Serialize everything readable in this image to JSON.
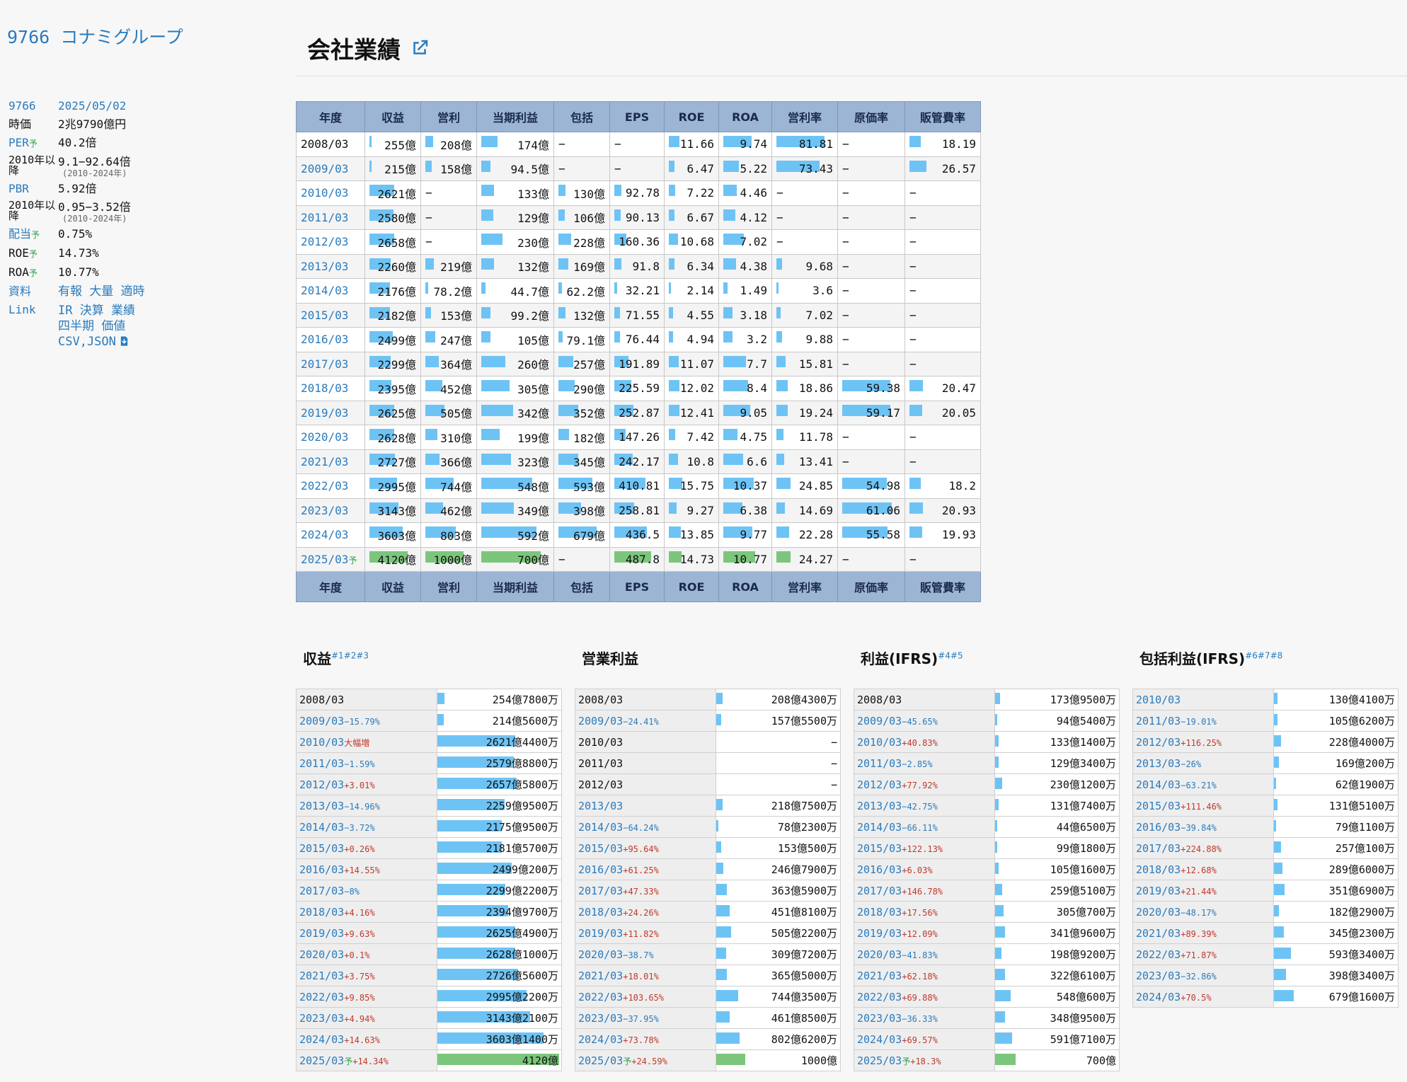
{
  "company": {
    "title": "9766 コナミグループ"
  },
  "side": {
    "code": "9766",
    "date": "2025/05/02",
    "rows": [
      {
        "k": "時価",
        "v": "2兆9790億円"
      },
      {
        "k": "PER",
        "yo": "予",
        "v": "40.2倍",
        "blue": true
      },
      {
        "k": "2010年以降",
        "v": "9.1−92.64倍",
        "note": "(2010-2024年)"
      },
      {
        "k": "PBR",
        "v": "5.92倍",
        "blue": true
      },
      {
        "k": "2010年以降",
        "v": "0.95−3.52倍",
        "note": "(2010-2024年)"
      },
      {
        "k": "配当",
        "yo": "予",
        "v": "0.75%",
        "blue": true
      },
      {
        "k": "ROE",
        "yo": "予",
        "v": "14.73%"
      },
      {
        "k": "ROA",
        "yo": "予",
        "v": "10.77%"
      }
    ],
    "docs_label": "資料",
    "docs": [
      "有報",
      "大量",
      "適時"
    ],
    "link_label": "Link",
    "links": [
      "IR",
      "決算",
      "業績",
      "四半期",
      "価値",
      "CSV,JSON"
    ]
  },
  "main": {
    "title": "会社業績"
  },
  "perf": {
    "headers": [
      "年度",
      "収益",
      "営利",
      "当期利益",
      "包括",
      "EPS",
      "ROE",
      "ROA",
      "営利率",
      "原価率",
      "販管費率"
    ],
    "rows": [
      {
        "y": "2008/03",
        "c": [
          "255億",
          "208億",
          "174億",
          "−",
          "−",
          "11.66",
          "9.74",
          "81.81",
          "−",
          "18.19"
        ],
        "b": [
          0.06,
          0.2,
          0.27,
          0,
          0,
          0.28,
          0.8,
          1.0,
          0,
          0.2
        ]
      },
      {
        "y": "2009/03",
        "c": [
          "215億",
          "158億",
          "94.5億",
          "−",
          "−",
          "6.47",
          "5.22",
          "73.43",
          "−",
          "26.57"
        ],
        "b": [
          0.05,
          0.16,
          0.15,
          0,
          0,
          0.16,
          0.43,
          0.9,
          0,
          0.29
        ]
      },
      {
        "y": "2010/03",
        "c": [
          "2621億",
          "−",
          "133億",
          "130億",
          "92.78",
          "7.22",
          "4.46",
          "−",
          "−",
          "−"
        ],
        "b": [
          0.64,
          0,
          0.21,
          0.19,
          0.19,
          0.17,
          0.37,
          0,
          0,
          0
        ]
      },
      {
        "y": "2011/03",
        "c": [
          "2580億",
          "−",
          "129億",
          "106億",
          "90.13",
          "6.67",
          "4.12",
          "−",
          "−",
          "−"
        ],
        "b": [
          0.63,
          0,
          0.2,
          0.16,
          0.18,
          0.16,
          0.34,
          0,
          0,
          0
        ]
      },
      {
        "y": "2012/03",
        "c": [
          "2658億",
          "−",
          "230億",
          "228億",
          "160.36",
          "10.68",
          "7.02",
          "−",
          "−",
          "−"
        ],
        "b": [
          0.65,
          0,
          0.36,
          0.34,
          0.33,
          0.25,
          0.58,
          0,
          0,
          0
        ]
      },
      {
        "y": "2013/03",
        "c": [
          "2260億",
          "219億",
          "132億",
          "169億",
          "91.8",
          "6.34",
          "4.38",
          "9.68",
          "−",
          "−"
        ],
        "b": [
          0.55,
          0.22,
          0.21,
          0.25,
          0.19,
          0.15,
          0.36,
          0.12,
          0,
          0
        ]
      },
      {
        "y": "2014/03",
        "c": [
          "2176億",
          "78.2億",
          "44.7億",
          "62.2億",
          "32.21",
          "2.14",
          "1.49",
          "3.6",
          "−",
          "−"
        ],
        "b": [
          0.53,
          0.08,
          0.07,
          0.09,
          0.07,
          0.05,
          0.12,
          0.04,
          0,
          0
        ]
      },
      {
        "y": "2015/03",
        "c": [
          "2182億",
          "153億",
          "99.2億",
          "132億",
          "71.55",
          "4.55",
          "3.18",
          "7.02",
          "−",
          "−"
        ],
        "b": [
          0.53,
          0.15,
          0.16,
          0.19,
          0.15,
          0.11,
          0.26,
          0.09,
          0,
          0
        ]
      },
      {
        "y": "2016/03",
        "c": [
          "2499億",
          "247億",
          "105億",
          "79.1億",
          "76.44",
          "4.94",
          "3.2",
          "9.88",
          "−",
          "−"
        ],
        "b": [
          0.61,
          0.25,
          0.16,
          0.12,
          0.16,
          0.12,
          0.26,
          0.12,
          0,
          0
        ]
      },
      {
        "y": "2017/03",
        "c": [
          "2299億",
          "364億",
          "260億",
          "257億",
          "191.89",
          "11.07",
          "7.7",
          "15.81",
          "−",
          "−"
        ],
        "b": [
          0.56,
          0.36,
          0.41,
          0.38,
          0.39,
          0.26,
          0.64,
          0.19,
          0,
          0
        ]
      },
      {
        "y": "2018/03",
        "c": [
          "2395億",
          "452億",
          "305億",
          "290億",
          "225.59",
          "12.02",
          "8.4",
          "18.86",
          "59.38",
          "20.47"
        ],
        "b": [
          0.58,
          0.45,
          0.48,
          0.43,
          0.46,
          0.28,
          0.69,
          0.23,
          0.97,
          0.23
        ]
      },
      {
        "y": "2019/03",
        "c": [
          "2625億",
          "505億",
          "342億",
          "352億",
          "252.87",
          "12.41",
          "9.05",
          "19.24",
          "59.17",
          "20.05"
        ],
        "b": [
          0.64,
          0.5,
          0.53,
          0.52,
          0.52,
          0.29,
          0.75,
          0.24,
          0.97,
          0.22
        ]
      },
      {
        "y": "2020/03",
        "c": [
          "2628億",
          "310億",
          "199億",
          "182億",
          "147.26",
          "7.42",
          "4.75",
          "11.78",
          "−",
          "−"
        ],
        "b": [
          0.64,
          0.31,
          0.31,
          0.27,
          0.3,
          0.17,
          0.39,
          0.14,
          0,
          0
        ]
      },
      {
        "y": "2021/03",
        "c": [
          "2727億",
          "366億",
          "323億",
          "345億",
          "242.17",
          "10.8",
          "6.6",
          "13.41",
          "−",
          "−"
        ],
        "b": [
          0.66,
          0.37,
          0.5,
          0.51,
          0.5,
          0.25,
          0.55,
          0.16,
          0,
          0
        ]
      },
      {
        "y": "2022/03",
        "c": [
          "2995億",
          "744億",
          "548億",
          "593億",
          "410.81",
          "15.75",
          "10.37",
          "24.85",
          "54.98",
          "18.2"
        ],
        "b": [
          0.73,
          0.74,
          0.86,
          0.88,
          0.84,
          0.37,
          0.86,
          0.3,
          0.9,
          0.2
        ]
      },
      {
        "y": "2023/03",
        "c": [
          "3143億",
          "462億",
          "349億",
          "398億",
          "258.81",
          "9.27",
          "6.38",
          "14.69",
          "61.06",
          "20.93"
        ],
        "b": [
          0.76,
          0.46,
          0.55,
          0.59,
          0.53,
          0.22,
          0.53,
          0.18,
          1.0,
          0.23
        ]
      },
      {
        "y": "2024/03",
        "c": [
          "3603億",
          "803億",
          "592億",
          "679億",
          "436.5",
          "13.85",
          "9.77",
          "22.28",
          "55.58",
          "19.93"
        ],
        "b": [
          0.87,
          0.8,
          0.93,
          1.0,
          0.89,
          0.33,
          0.81,
          0.27,
          0.91,
          0.22
        ]
      },
      {
        "y": "2025/03",
        "yo": "予",
        "forecast": true,
        "c": [
          "4120億",
          "1000億",
          "700億",
          "−",
          "487.8",
          "14.73",
          "10.77",
          "24.27",
          "−",
          "−"
        ],
        "b": [
          1.0,
          1.0,
          1.0,
          0,
          1.0,
          0.35,
          0.89,
          0.3,
          0,
          0
        ]
      }
    ]
  },
  "minis": [
    {
      "title": "収益",
      "sup": "#1#2#3",
      "rows": [
        {
          "y": "2008/03",
          "p": "",
          "v": "254億7800万",
          "b": 0.06,
          "plain": true
        },
        {
          "y": "2009/03",
          "p": "−15.79%",
          "s": "neg",
          "v": "214億5600万",
          "b": 0.05
        },
        {
          "y": "2010/03",
          "p": "大幅増",
          "s": "pos",
          "v": "2621億4400万",
          "b": 0.64
        },
        {
          "y": "2011/03",
          "p": "−1.59%",
          "s": "neg",
          "v": "2579億8800万",
          "b": 0.63
        },
        {
          "y": "2012/03",
          "p": "+3.01%",
          "s": "pos",
          "v": "2657億5800万",
          "b": 0.65
        },
        {
          "y": "2013/03",
          "p": "−14.96%",
          "s": "neg",
          "v": "2259億9500万",
          "b": 0.55
        },
        {
          "y": "2014/03",
          "p": "−3.72%",
          "s": "neg",
          "v": "2175億9500万",
          "b": 0.53
        },
        {
          "y": "2015/03",
          "p": "+0.26%",
          "s": "pos",
          "v": "2181億5700万",
          "b": 0.53
        },
        {
          "y": "2016/03",
          "p": "+14.55%",
          "s": "pos",
          "v": "2499億200万",
          "b": 0.61
        },
        {
          "y": "2017/03",
          "p": "−8%",
          "s": "neg",
          "v": "2299億2200万",
          "b": 0.56
        },
        {
          "y": "2018/03",
          "p": "+4.16%",
          "s": "pos",
          "v": "2394億9700万",
          "b": 0.58
        },
        {
          "y": "2019/03",
          "p": "+9.63%",
          "s": "pos",
          "v": "2625億4900万",
          "b": 0.64
        },
        {
          "y": "2020/03",
          "p": "+0.1%",
          "s": "pos",
          "v": "2628億1000万",
          "b": 0.64
        },
        {
          "y": "2021/03",
          "p": "+3.75%",
          "s": "pos",
          "v": "2726億5600万",
          "b": 0.66
        },
        {
          "y": "2022/03",
          "p": "+9.85%",
          "s": "pos",
          "v": "2995億2200万",
          "b": 0.73
        },
        {
          "y": "2023/03",
          "p": "+4.94%",
          "s": "pos",
          "v": "3143億2100万",
          "b": 0.76
        },
        {
          "y": "2024/03",
          "p": "+14.63%",
          "s": "pos",
          "v": "3603億1400万",
          "b": 0.87
        },
        {
          "y": "2025/03",
          "yo": "予",
          "p": "+14.34%",
          "s": "pos",
          "v": "4120億",
          "b": 1.0,
          "g": true
        }
      ]
    },
    {
      "title": "営業利益",
      "sup": "",
      "rows": [
        {
          "y": "2008/03",
          "p": "",
          "v": "208億4300万",
          "b": 0.05,
          "plain": true
        },
        {
          "y": "2009/03",
          "p": "−24.41%",
          "s": "neg",
          "v": "157億5500万",
          "b": 0.04
        },
        {
          "y": "2010/03",
          "p": "",
          "v": "−",
          "b": 0,
          "plain": true
        },
        {
          "y": "2011/03",
          "p": "",
          "v": "−",
          "b": 0,
          "plain": true
        },
        {
          "y": "2012/03",
          "p": "",
          "v": "−",
          "b": 0,
          "plain": true
        },
        {
          "y": "2013/03",
          "p": "",
          "v": "218億7500万",
          "b": 0.05
        },
        {
          "y": "2014/03",
          "p": "−64.24%",
          "s": "neg",
          "v": "78億2300万",
          "b": 0.02
        },
        {
          "y": "2015/03",
          "p": "+95.64%",
          "s": "pos",
          "v": "153億500万",
          "b": 0.04
        },
        {
          "y": "2016/03",
          "p": "+61.25%",
          "s": "pos",
          "v": "246億7900万",
          "b": 0.06
        },
        {
          "y": "2017/03",
          "p": "+47.33%",
          "s": "pos",
          "v": "363億5900万",
          "b": 0.09
        },
        {
          "y": "2018/03",
          "p": "+24.26%",
          "s": "pos",
          "v": "451億8100万",
          "b": 0.11
        },
        {
          "y": "2019/03",
          "p": "+11.82%",
          "s": "pos",
          "v": "505億2200万",
          "b": 0.12
        },
        {
          "y": "2020/03",
          "p": "−38.7%",
          "s": "neg",
          "v": "309億7200万",
          "b": 0.08
        },
        {
          "y": "2021/03",
          "p": "+18.01%",
          "s": "pos",
          "v": "365億5000万",
          "b": 0.09
        },
        {
          "y": "2022/03",
          "p": "+103.65%",
          "s": "pos",
          "v": "744億3500万",
          "b": 0.18
        },
        {
          "y": "2023/03",
          "p": "−37.95%",
          "s": "neg",
          "v": "461億8500万",
          "b": 0.11
        },
        {
          "y": "2024/03",
          "p": "+73.78%",
          "s": "pos",
          "v": "802億6200万",
          "b": 0.19
        },
        {
          "y": "2025/03",
          "yo": "予",
          "p": "+24.59%",
          "s": "pos",
          "v": "1000億",
          "b": 0.24,
          "g": true
        }
      ]
    },
    {
      "title": "利益(IFRS)",
      "sup": "#4#5",
      "rows": [
        {
          "y": "2008/03",
          "p": "",
          "v": "173億9500万",
          "b": 0.04,
          "plain": true
        },
        {
          "y": "2009/03",
          "p": "−45.65%",
          "s": "neg",
          "v": "94億5400万",
          "b": 0.02
        },
        {
          "y": "2010/03",
          "p": "+40.83%",
          "s": "pos",
          "v": "133億1400万",
          "b": 0.03
        },
        {
          "y": "2011/03",
          "p": "−2.85%",
          "s": "neg",
          "v": "129億3400万",
          "b": 0.03
        },
        {
          "y": "2012/03",
          "p": "+77.92%",
          "s": "pos",
          "v": "230億1200万",
          "b": 0.06
        },
        {
          "y": "2013/03",
          "p": "−42.75%",
          "s": "neg",
          "v": "131億7400万",
          "b": 0.03
        },
        {
          "y": "2014/03",
          "p": "−66.11%",
          "s": "neg",
          "v": "44億6500万",
          "b": 0.01
        },
        {
          "y": "2015/03",
          "p": "+122.13%",
          "s": "pos",
          "v": "99億1800万",
          "b": 0.02
        },
        {
          "y": "2016/03",
          "p": "+6.03%",
          "s": "pos",
          "v": "105億1600万",
          "b": 0.03
        },
        {
          "y": "2017/03",
          "p": "+146.78%",
          "s": "pos",
          "v": "259億5100万",
          "b": 0.06
        },
        {
          "y": "2018/03",
          "p": "+17.56%",
          "s": "pos",
          "v": "305億700万",
          "b": 0.07
        },
        {
          "y": "2019/03",
          "p": "+12.09%",
          "s": "pos",
          "v": "341億9600万",
          "b": 0.08
        },
        {
          "y": "2020/03",
          "p": "−41.83%",
          "s": "neg",
          "v": "198億9200万",
          "b": 0.05
        },
        {
          "y": "2021/03",
          "p": "+62.18%",
          "s": "pos",
          "v": "322億6100万",
          "b": 0.08
        },
        {
          "y": "2022/03",
          "p": "+69.88%",
          "s": "pos",
          "v": "548億600万",
          "b": 0.13
        },
        {
          "y": "2023/03",
          "p": "−36.33%",
          "s": "neg",
          "v": "348億9500万",
          "b": 0.08
        },
        {
          "y": "2024/03",
          "p": "+69.57%",
          "s": "pos",
          "v": "591億7100万",
          "b": 0.14
        },
        {
          "y": "2025/03",
          "yo": "予",
          "p": "+18.3%",
          "s": "pos",
          "v": "700億",
          "b": 0.17,
          "g": true
        }
      ]
    },
    {
      "title": "包括利益(IFRS)",
      "sup": "#6#7#8",
      "rows": [
        {
          "y": "2010/03",
          "p": "",
          "v": "130億4100万",
          "b": 0.03
        },
        {
          "y": "2011/03",
          "p": "−19.01%",
          "s": "neg",
          "v": "105億6200万",
          "b": 0.03
        },
        {
          "y": "2012/03",
          "p": "+116.25%",
          "s": "pos",
          "v": "228億4000万",
          "b": 0.06
        },
        {
          "y": "2013/03",
          "p": "−26%",
          "s": "neg",
          "v": "169億200万",
          "b": 0.04
        },
        {
          "y": "2014/03",
          "p": "−63.21%",
          "s": "neg",
          "v": "62億1900万",
          "b": 0.02
        },
        {
          "y": "2015/03",
          "p": "+111.46%",
          "s": "pos",
          "v": "131億5100万",
          "b": 0.03
        },
        {
          "y": "2016/03",
          "p": "−39.84%",
          "s": "neg",
          "v": "79億1100万",
          "b": 0.02
        },
        {
          "y": "2017/03",
          "p": "+224.88%",
          "s": "pos",
          "v": "257億100万",
          "b": 0.06
        },
        {
          "y": "2018/03",
          "p": "+12.68%",
          "s": "pos",
          "v": "289億6000万",
          "b": 0.07
        },
        {
          "y": "2019/03",
          "p": "+21.44%",
          "s": "pos",
          "v": "351億6900万",
          "b": 0.09
        },
        {
          "y": "2020/03",
          "p": "−48.17%",
          "s": "neg",
          "v": "182億2900万",
          "b": 0.04
        },
        {
          "y": "2021/03",
          "p": "+89.39%",
          "s": "pos",
          "v": "345億2300万",
          "b": 0.08
        },
        {
          "y": "2022/03",
          "p": "+71.87%",
          "s": "pos",
          "v": "593億3400万",
          "b": 0.14
        },
        {
          "y": "2023/03",
          "p": "−32.86%",
          "s": "neg",
          "v": "398億3400万",
          "b": 0.1
        },
        {
          "y": "2024/03",
          "p": "+70.5%",
          "s": "pos",
          "v": "679億1600万",
          "b": 0.16
        }
      ]
    }
  ]
}
